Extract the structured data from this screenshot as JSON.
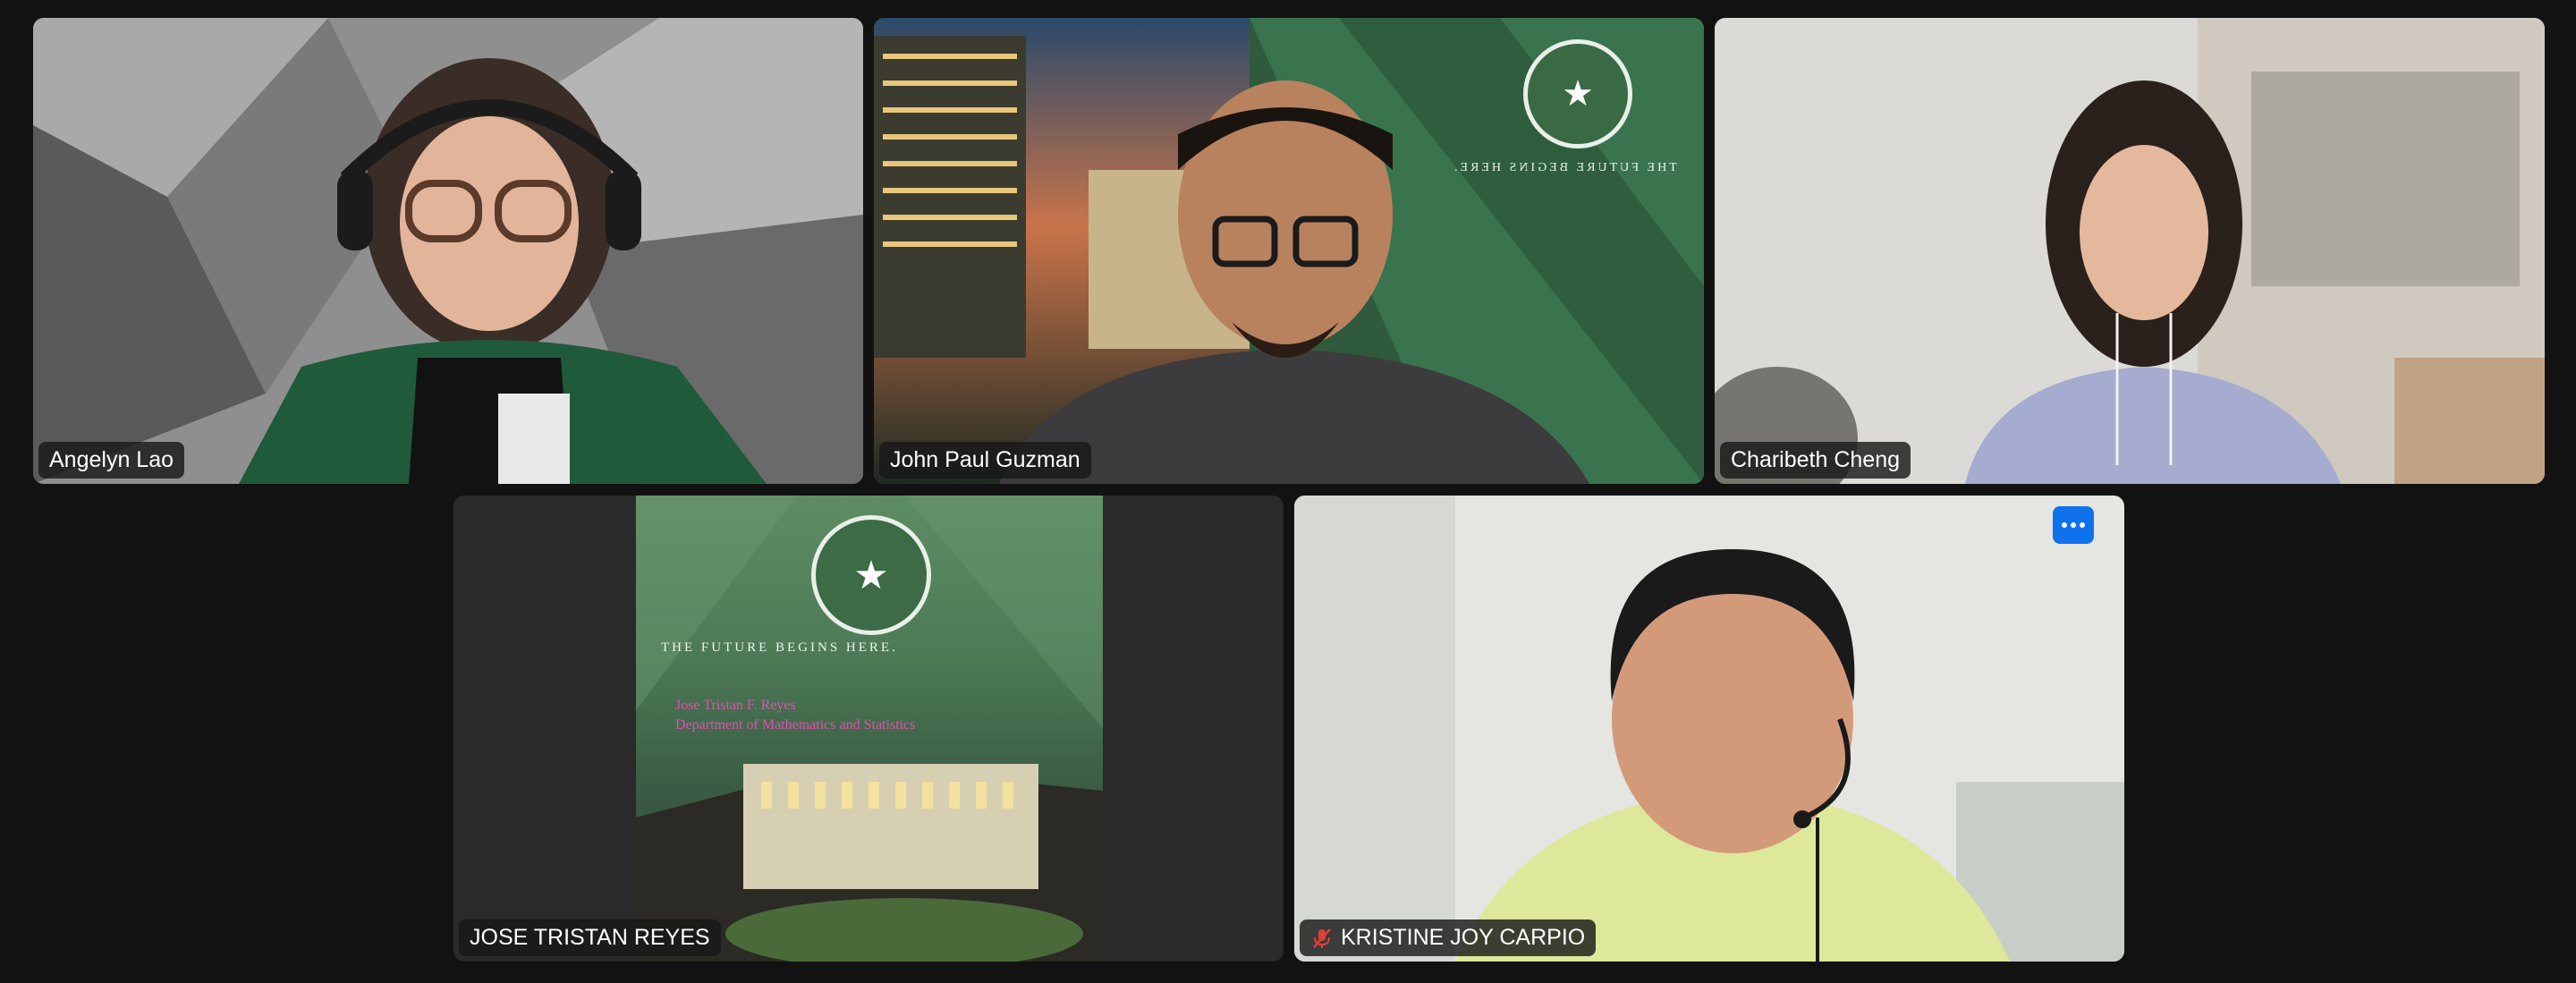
{
  "participants": [
    {
      "name": "Angelyn Lao",
      "active_speaker": false,
      "muted": false
    },
    {
      "name": "John Paul Guzman",
      "active_speaker": true,
      "muted": false,
      "background_text": "THE FUTURE BEGINS HERE."
    },
    {
      "name": "Charibeth Cheng",
      "active_speaker": false,
      "muted": false
    },
    {
      "name": "JOSE TRISTAN REYES",
      "active_speaker": false,
      "muted": false,
      "shared_slide": {
        "tagline": "THE FUTURE BEGINS HERE.",
        "presenter": "Jose Tristan F. Reyes",
        "department": "Department of Mathematics and Statistics"
      }
    },
    {
      "name": "KRISTINE JOY CARPIO",
      "active_speaker": false,
      "muted": true
    }
  ],
  "icons": {
    "more_options": "ellipsis-icon",
    "muted": "mic-muted-icon"
  },
  "colors": {
    "active_border": "#2fd36b",
    "more_button": "#0e72ed",
    "mute_icon": "#e0403a",
    "slide_text": "#e14fb0"
  }
}
